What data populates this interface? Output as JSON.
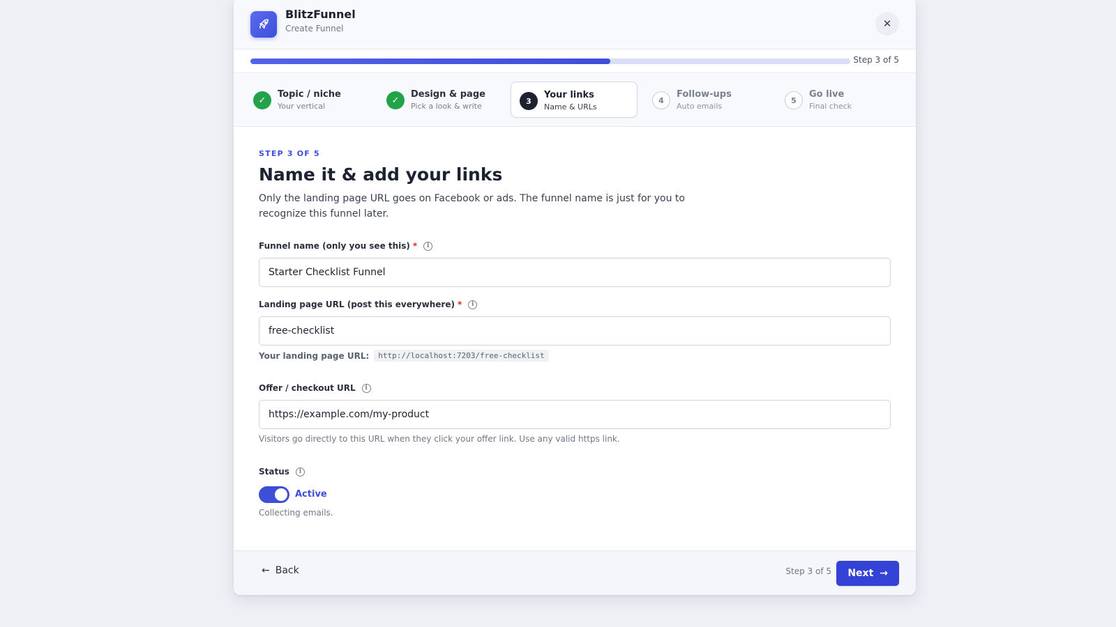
{
  "app": {
    "name": "BlitzFunnel",
    "subtitle": "Create Funnel",
    "logo_icon": "rocket-icon"
  },
  "progress": {
    "value": 0.6,
    "label": "Step 3 of 5"
  },
  "steps": [
    {
      "number": "1",
      "title": "Topic / niche",
      "subtitle": "Your vertical",
      "state": "done"
    },
    {
      "number": "2",
      "title": "Design & page",
      "subtitle": "Pick a look & write",
      "state": "done"
    },
    {
      "number": "3",
      "title": "Your links",
      "subtitle": "Name & URLs",
      "state": "current"
    },
    {
      "number": "4",
      "title": "Follow-ups",
      "subtitle": "Auto emails",
      "state": "todo"
    },
    {
      "number": "5",
      "title": "Go live",
      "subtitle": "Final check",
      "state": "todo"
    }
  ],
  "content": {
    "eyebrow": "STEP 3 OF 5",
    "title": "Name it & add your links",
    "description": "Only the landing page URL goes on Facebook or ads. The funnel name is just for you to recognize this funnel later."
  },
  "fields": {
    "funnel_name": {
      "label": "Funnel name (only you see this)",
      "required": "*",
      "value": "Starter Checklist Funnel"
    },
    "landing_url": {
      "label": "Landing page URL (post this everywhere)",
      "required": "*",
      "value": "free-checklist",
      "preview_label": "Your landing page URL:",
      "preview_value": "http://localhost:7203/free-checklist"
    },
    "offer_url": {
      "label": "Offer / checkout URL",
      "value": "https://example.com/my-product",
      "help": "Visitors go directly to this URL when they click your offer link. Use any valid https link."
    },
    "status": {
      "label": "Status",
      "toggle_label": "Active",
      "on": true,
      "help": "Collecting emails."
    }
  },
  "footer": {
    "back_label": "Back",
    "step_label": "Step 3 of 5",
    "next_label": "Next"
  },
  "colors": {
    "accent": "#3d4fd8",
    "success": "#22a34a",
    "required": "#e02424"
  }
}
